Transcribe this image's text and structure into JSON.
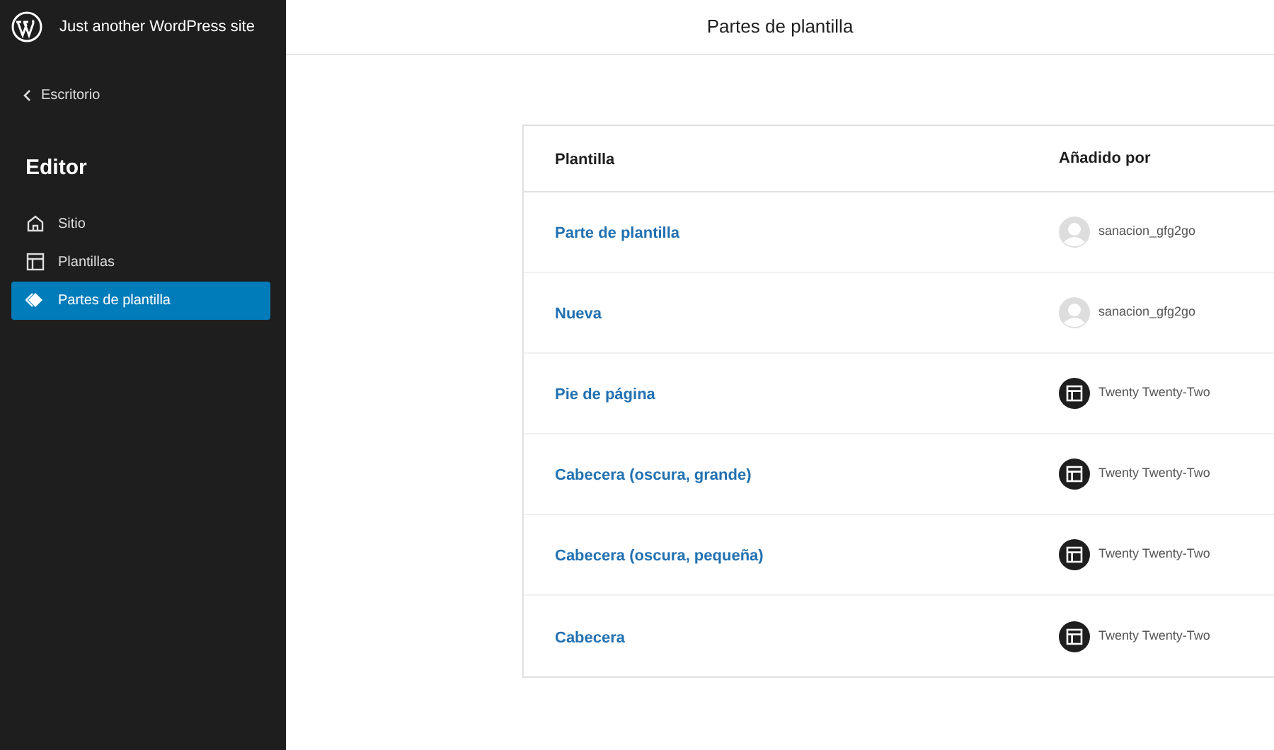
{
  "sidebar": {
    "site_title": "Just another WordPress site",
    "back_link": "Escritorio",
    "heading": "Editor",
    "items": [
      {
        "label": "Sitio",
        "selected": false
      },
      {
        "label": "Plantillas",
        "selected": false
      },
      {
        "label": "Partes de plantilla",
        "selected": true
      }
    ]
  },
  "header": {
    "title": "Partes de plantilla"
  },
  "table": {
    "columns": [
      "Plantilla",
      "Añadido por"
    ],
    "rows": [
      {
        "name": "Parte de plantilla",
        "author": "sanacion_gfg2go",
        "kind": "user"
      },
      {
        "name": "Nueva",
        "author": "sanacion_gfg2go",
        "kind": "user"
      },
      {
        "name": "Pie de página",
        "author": "Twenty Twenty-Two",
        "kind": "theme"
      },
      {
        "name": "Cabecera (oscura, grande)",
        "author": "Twenty Twenty-Two",
        "kind": "theme"
      },
      {
        "name": "Cabecera (oscura, pequeña)",
        "author": "Twenty Twenty-Two",
        "kind": "theme"
      },
      {
        "name": "Cabecera",
        "author": "Twenty Twenty-Two",
        "kind": "theme"
      }
    ]
  }
}
